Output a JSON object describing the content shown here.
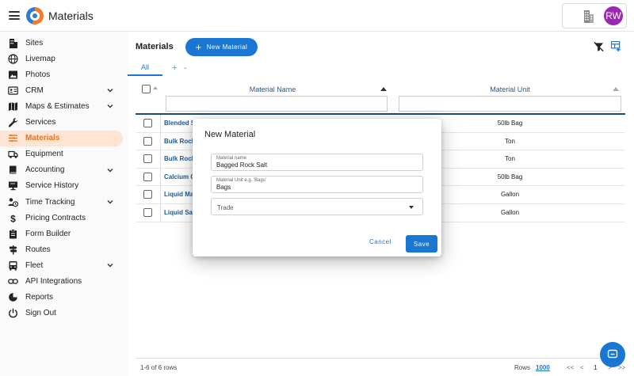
{
  "app": {
    "title": "Materials",
    "avatar_initials": "RW"
  },
  "colors": {
    "primary": "#1976d2",
    "accent": "#e8711f",
    "avatar": "#9c27b0",
    "active_bg": "#fde4d3"
  },
  "sidebar": {
    "items": [
      {
        "label": "Sites",
        "icon": "building-icon"
      },
      {
        "label": "Livemap",
        "icon": "globe-icon"
      },
      {
        "label": "Photos",
        "icon": "image-icon"
      },
      {
        "label": "CRM",
        "icon": "contact-card-icon",
        "expandable": true
      },
      {
        "label": "Maps & Estimates",
        "icon": "map-icon",
        "expandable": true
      },
      {
        "label": "Services",
        "icon": "wrench-icon"
      },
      {
        "label": "Materials",
        "icon": "layers-icon",
        "active": true
      },
      {
        "label": "Equipment",
        "icon": "truck-icon"
      },
      {
        "label": "Accounting",
        "icon": "book-icon",
        "expandable": true
      },
      {
        "label": "Service History",
        "icon": "monitor-icon"
      },
      {
        "label": "Time Tracking",
        "icon": "clock-person-icon",
        "expandable": true
      },
      {
        "label": "Pricing Contracts",
        "icon": "dollar-icon"
      },
      {
        "label": "Form Builder",
        "icon": "clipboard-icon"
      },
      {
        "label": "Routes",
        "icon": "signpost-icon"
      },
      {
        "label": "Fleet",
        "icon": "bus-icon",
        "expandable": true
      },
      {
        "label": "API Integrations",
        "icon": "link-icon"
      },
      {
        "label": "Reports",
        "icon": "chart-icon"
      },
      {
        "label": "Sign Out",
        "icon": "power-icon"
      }
    ]
  },
  "main": {
    "title": "Materials",
    "new_button": "New Material",
    "tabs": {
      "all": "All",
      "add": "+",
      "remove": "-"
    },
    "columns": {
      "name": "Material Name",
      "unit": "Material Unit"
    },
    "rows": [
      {
        "name": "Blended S",
        "unit": "50lb Bag"
      },
      {
        "name": "Bulk Rock",
        "unit": "Ton"
      },
      {
        "name": "Bulk Rock",
        "unit": "Ton"
      },
      {
        "name": "Calcium C",
        "unit": "50lb Bag"
      },
      {
        "name": "Liquid Ma",
        "unit": "Gallon"
      },
      {
        "name": "Liquid Sal",
        "unit": "Gallon"
      }
    ],
    "footer": {
      "range": "1-6 of 6 rows",
      "rows_label": "Rows",
      "rows_value": "1000",
      "first": "<<",
      "prev": "<",
      "page": "1",
      "next": ">",
      "last": ">>"
    }
  },
  "modal": {
    "title": "New Material",
    "name_label": "Material name",
    "name_value": "Bagged Rock Salt",
    "unit_label": "Material Unit e.g. 'Bags'",
    "unit_value": "Bags",
    "trade_value": "Trade",
    "cancel": "Cancel",
    "save": "Save"
  }
}
